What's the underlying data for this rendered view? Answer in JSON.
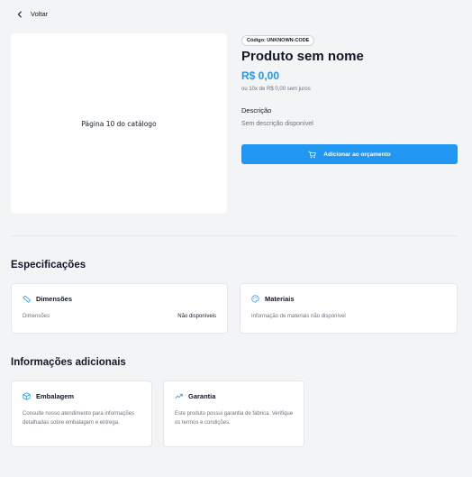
{
  "nav": {
    "back_label": "Voltar",
    "back_icon": "chevron-left-icon"
  },
  "product": {
    "image_caption": "Página 10 do catálogo",
    "code_badge": "Código: UNKNOWN-CODE",
    "title": "Produto sem nome",
    "price": "R$ 0,00",
    "installments": "ou 10x de R$ 0,00 sem juros",
    "description_heading": "Descrição",
    "description_text": "Sem descrição disponível",
    "add_button_label": "Adicionar ao orçamento",
    "add_button_icon": "cart-icon"
  },
  "specs": {
    "title": "Especificações",
    "dimensions": {
      "title": "Dimensões",
      "icon": "ruler-icon",
      "row_label": "Dimensões",
      "row_value": "Não disponíveis"
    },
    "materials": {
      "title": "Materiais",
      "icon": "palette-icon",
      "text": "Informação de materiais não disponível"
    }
  },
  "additional": {
    "title": "Informações adicionais",
    "packaging": {
      "title": "Embalagem",
      "icon": "box-icon",
      "text": "Consulte nosso atendimento para informações detalhadas sobre embalagem e entrega."
    },
    "warranty": {
      "title": "Garantia",
      "icon": "trending-up-icon",
      "text": "Este produto possui garantia de fábrica. Verifique os termos e condições."
    }
  },
  "colors": {
    "accent": "#2196f3",
    "background": "#f3f4f6",
    "card": "#ffffff",
    "muted_text": "#6b7280"
  }
}
